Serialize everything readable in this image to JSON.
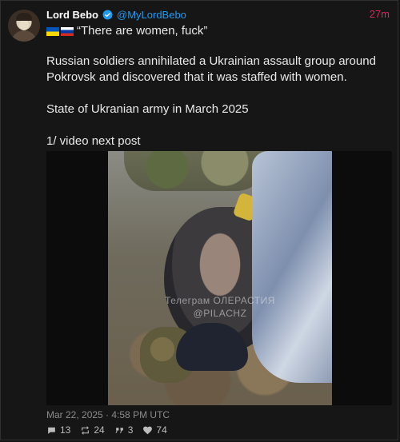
{
  "post": {
    "author_name": "Lord Bebo",
    "handle": "@MyLordBebo",
    "time_ago": "27m",
    "quote": "“There are women, fuck”",
    "paragraphs": [
      "Russian soldiers annihilated a Ukrainian assault group around Pokrovsk and discovered that it was staffed with women.",
      "State of Ukranian army in March 2025",
      "1/ video next post"
    ],
    "watermark_line1": "Телеграм ОЛЕРАСТИЯ",
    "watermark_line2": "@PILACHZ",
    "timestamp": "Mar 22, 2025 · 4:58 PM UTC",
    "stats": {
      "replies": "13",
      "retweets": "24",
      "quotes": "3",
      "likes": "74"
    }
  },
  "colors": {
    "background": "#161616",
    "handle": "#1d9bf0",
    "time": "#e0245e",
    "verified_badge": "#1d9bf0"
  },
  "icons": {
    "verified": "verified-badge-icon",
    "reply": "comment-icon",
    "retweet": "retweet-icon",
    "quote": "quote-icon",
    "like": "heart-icon"
  }
}
